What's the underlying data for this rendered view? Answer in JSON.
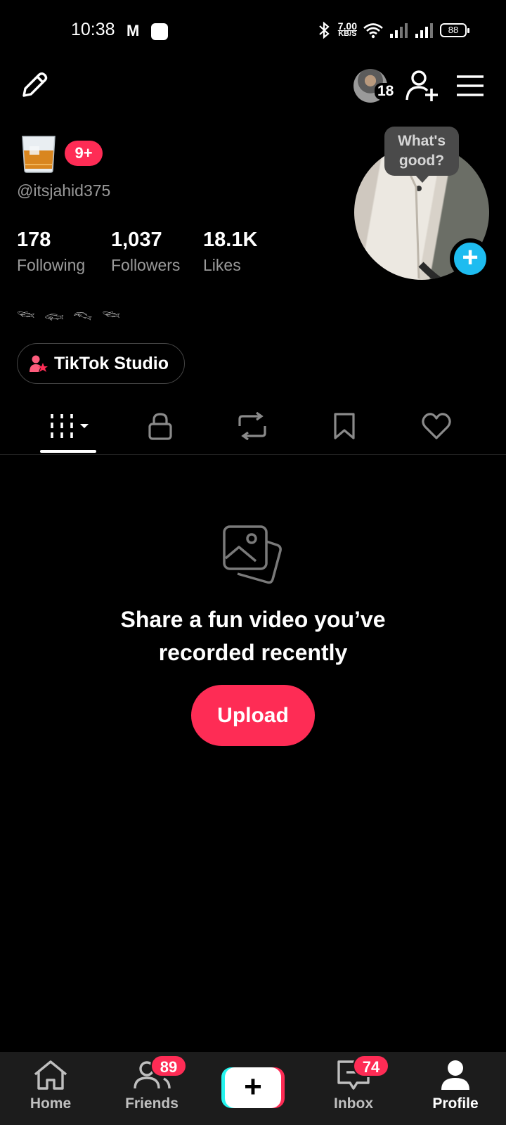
{
  "status_bar": {
    "time": "10:38",
    "mail_glyph": "M",
    "net_speed_value": "7.00",
    "net_speed_unit": "KB/S",
    "battery": "88"
  },
  "top_bar": {
    "friend_avatar_count": "18"
  },
  "profile": {
    "notification_badge": "9+",
    "username": "@itsjahid375",
    "stats": [
      {
        "value": "178",
        "label": "Following"
      },
      {
        "value": "1,037",
        "label": "Followers"
      },
      {
        "value": "18.1K",
        "label": "Likes"
      }
    ],
    "bubble_text": "What's good?",
    "bio": "𓆝 𓆟 𓆞 𓆝",
    "studio_button": "TikTok Studio"
  },
  "tabs": [
    "videos",
    "private",
    "reposts",
    "favorites",
    "liked"
  ],
  "empty_state": {
    "line1": "Share a fun video you’ve",
    "line2": "recorded recently",
    "upload_button": "Upload"
  },
  "bottom_nav": {
    "home": "Home",
    "friends": "Friends",
    "friends_badge": "89",
    "create": "+",
    "inbox": "Inbox",
    "inbox_badge": "74",
    "profile": "Profile"
  },
  "colors": {
    "accent_red": "#fe2c55",
    "accent_cyan": "#25f4ee",
    "story_blue": "#1ebcf0",
    "background": "#000000"
  }
}
